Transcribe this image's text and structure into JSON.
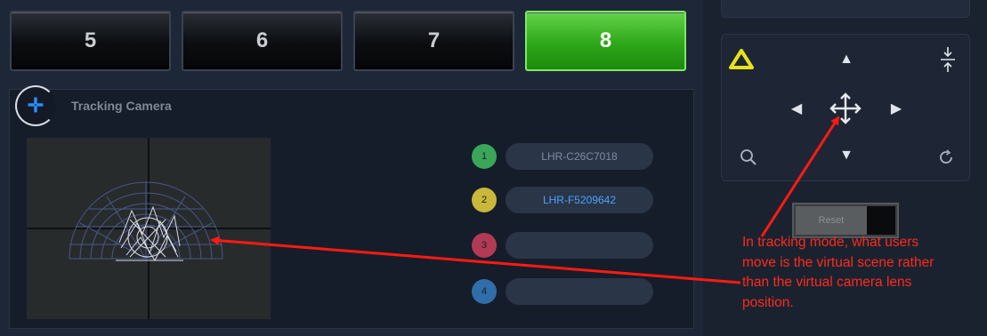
{
  "tabs": [
    {
      "label": "5",
      "active": false
    },
    {
      "label": "6",
      "active": false
    },
    {
      "label": "7",
      "active": false
    },
    {
      "label": "8",
      "active": true
    }
  ],
  "tracking": {
    "title": "Tracking Camera",
    "devices": [
      {
        "number": "1",
        "label": "LHR-C26C7018",
        "color": "#3aa65a",
        "text_color": "#7e8aa0"
      },
      {
        "number": "2",
        "label": "LHR-F5209642",
        "color": "#c9b83a",
        "text_color": "#4aa3ff"
      },
      {
        "number": "3",
        "label": "",
        "color": "#b23a55",
        "text_color": "#7e8aa0"
      },
      {
        "number": "4",
        "label": "",
        "color": "#2f6ea8",
        "text_color": "#7e8aa0"
      }
    ]
  },
  "nav_pad": {
    "icons": [
      "vive-logo-icon",
      "arrow-up-icon",
      "split-vertical-icon",
      "arrow-left-icon",
      "move-icon",
      "arrow-right-icon",
      "zoom-icon",
      "arrow-down-icon",
      "rotate-icon"
    ]
  },
  "reset": {
    "label": "Reset"
  },
  "annotation": {
    "text": "In tracking mode, what users move is the virtual scene rather than the virtual camera lens position.",
    "color": "#ff2a1a"
  },
  "colors": {
    "active_tab": "#2ea81a",
    "accent_blue": "#2a8fff"
  }
}
